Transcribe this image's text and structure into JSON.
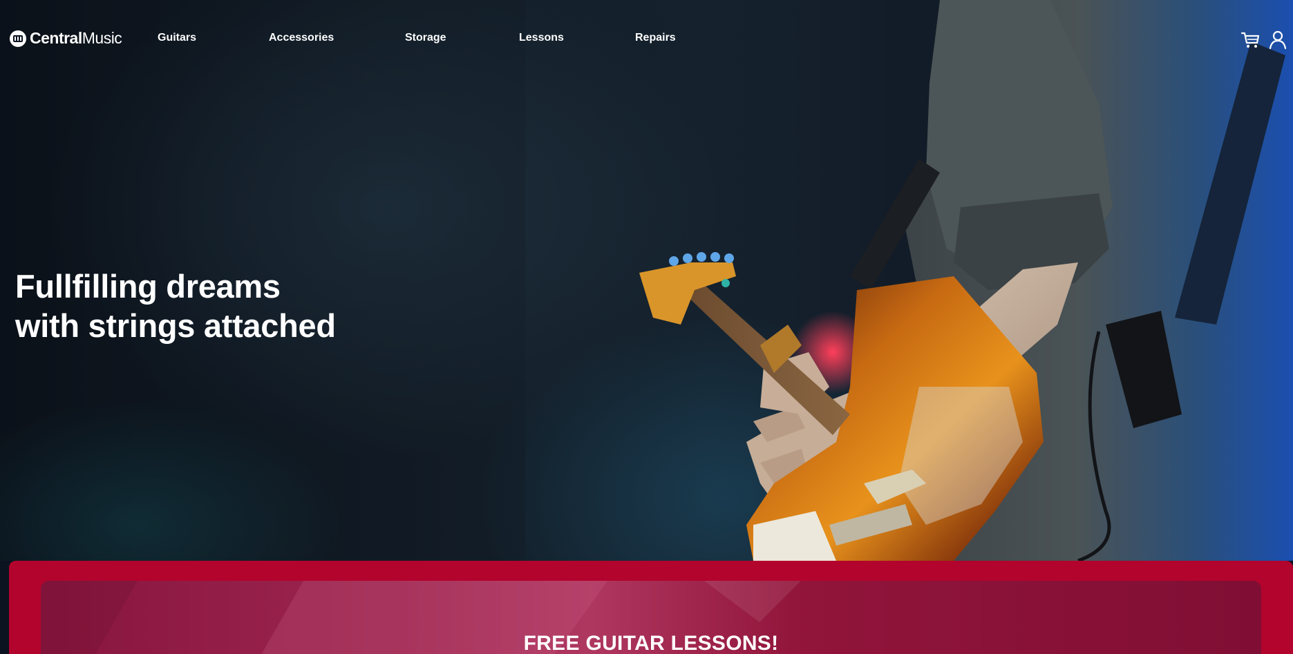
{
  "brand": {
    "name_bold": "Central",
    "name_light": "Music",
    "icon": "guitar-amp-logo-icon"
  },
  "nav": {
    "items": [
      {
        "label": "Guitars"
      },
      {
        "label": "Accessories"
      },
      {
        "label": "Storage"
      },
      {
        "label": "Lessons"
      },
      {
        "label": "Repairs"
      }
    ],
    "icons": [
      "cart-icon",
      "user-icon"
    ]
  },
  "hero": {
    "headline": "Fullfilling dreams with strings attached",
    "image": "guitarist-playing-electric-guitar-photo"
  },
  "promo": {
    "title": "FREE GUITAR LESSONS!",
    "accent_color": "#b2042d"
  },
  "colors": {
    "text": "#ffffff",
    "hero_background": "#0b1320",
    "promo_band": "#b2042d"
  }
}
